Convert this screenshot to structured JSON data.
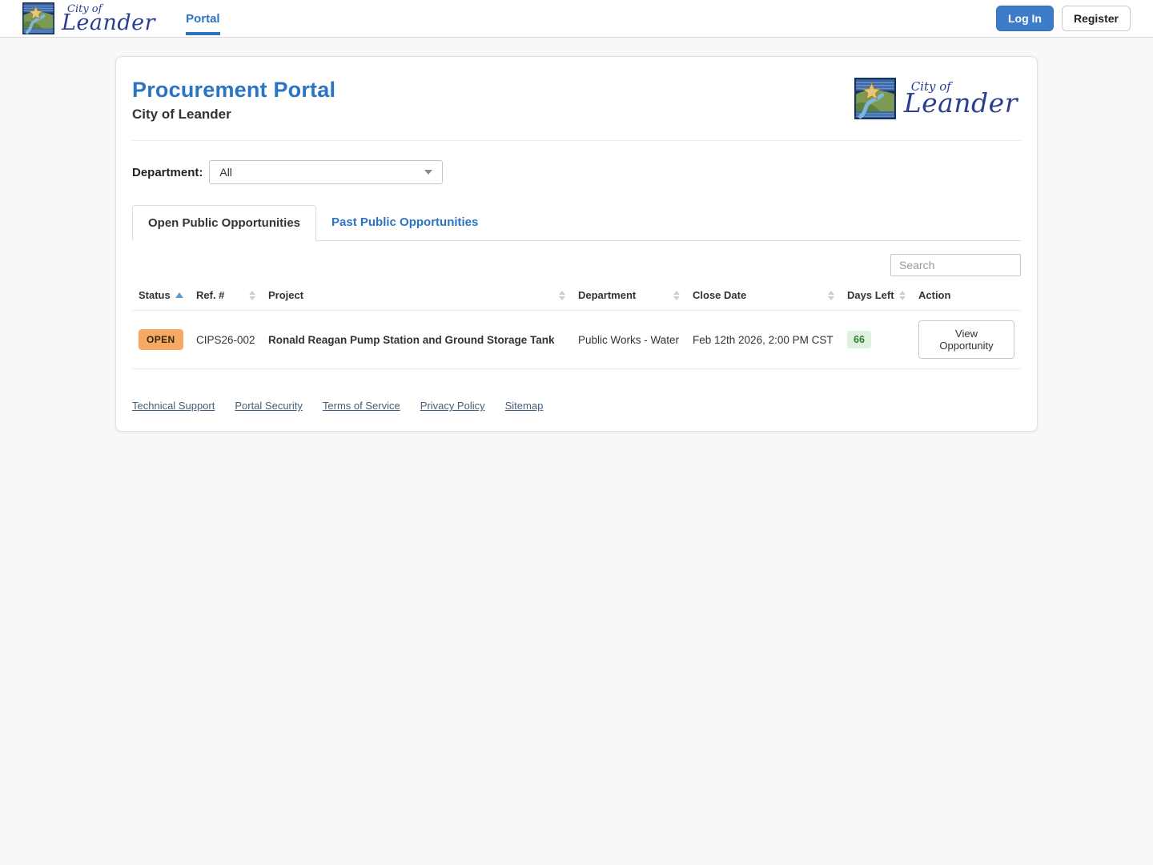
{
  "navbar": {
    "brand": {
      "city_of": "City of",
      "name": "Leander"
    },
    "portal_link": "Portal",
    "login_button": "Log In",
    "register_button": "Register"
  },
  "header": {
    "title": "Procurement Portal",
    "subtitle": "City of Leander",
    "logo": {
      "city_of": "City of",
      "name": "Leander"
    }
  },
  "filters": {
    "department_label": "Department:",
    "department_value": "All"
  },
  "tabs": [
    {
      "label": "Open Public Opportunities",
      "active": true
    },
    {
      "label": "Past Public Opportunities",
      "active": false
    }
  ],
  "search": {
    "placeholder": "Search"
  },
  "table": {
    "columns": [
      {
        "label": "Status",
        "sort": "asc"
      },
      {
        "label": "Ref. #",
        "sort": "none"
      },
      {
        "label": "Project",
        "sort": "none"
      },
      {
        "label": "Department",
        "sort": "none"
      },
      {
        "label": "Close Date",
        "sort": "none"
      },
      {
        "label": "Days Left",
        "sort": "none"
      },
      {
        "label": "Action",
        "sort": null
      }
    ],
    "rows": [
      {
        "status": "OPEN",
        "ref": "CIPS26-002",
        "project": "Ronald Reagan Pump Station and Ground Storage Tank",
        "department": "Public Works - Water",
        "close_date": "Feb 12th 2026, 2:00 PM CST",
        "days_left": "66",
        "action": "View Opportunity"
      }
    ]
  },
  "footer": {
    "links": [
      "Technical Support",
      "Portal Security",
      "Terms of Service",
      "Privacy Policy",
      "Sitemap"
    ]
  },
  "colors": {
    "primary_blue": "#2b74c4",
    "login_button_bg": "#3d7cc9",
    "open_badge_bg": "#f5a963",
    "days_left_badge_bg": "#dff1df",
    "days_left_badge_text": "#2f7d33",
    "footer_link": "#45607b",
    "logo_navy": "#2b3f8e"
  }
}
